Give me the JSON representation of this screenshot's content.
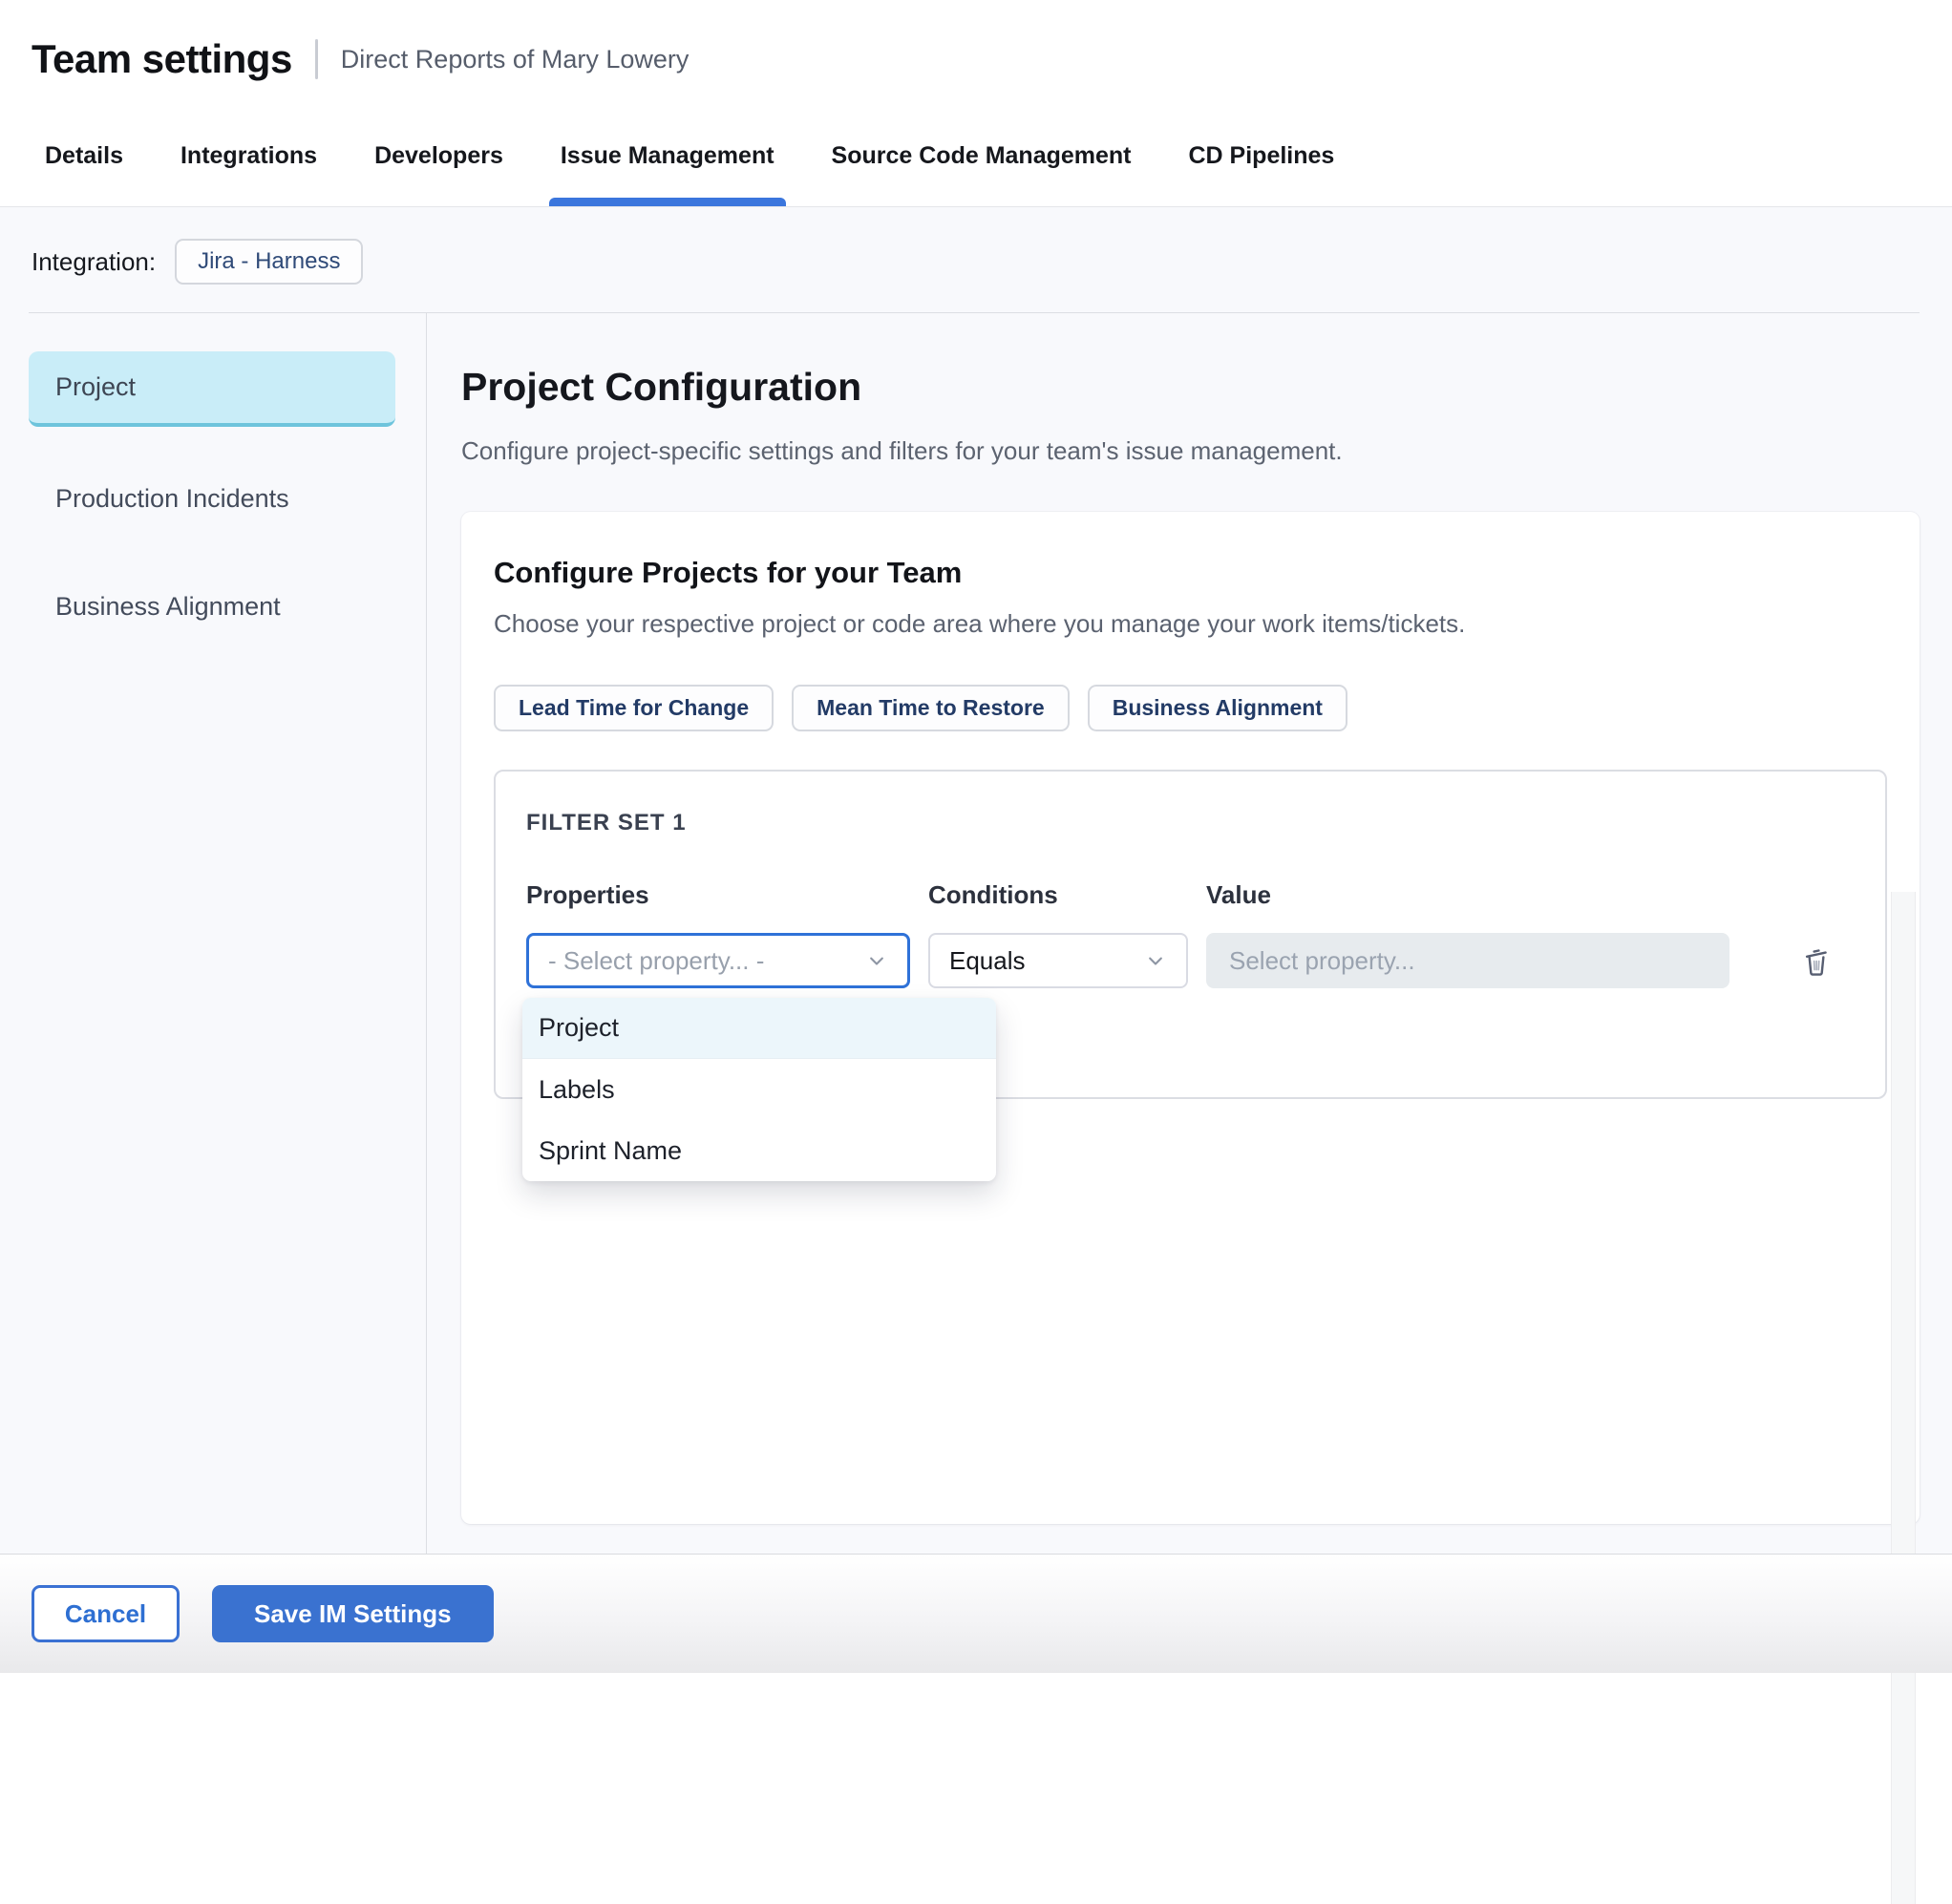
{
  "header": {
    "title": "Team settings",
    "subtitle": "Direct Reports of Mary Lowery"
  },
  "tabs": {
    "items": [
      {
        "label": "Details",
        "active": false
      },
      {
        "label": "Integrations",
        "active": false
      },
      {
        "label": "Developers",
        "active": false
      },
      {
        "label": "Issue Management",
        "active": true
      },
      {
        "label": "Source Code Management",
        "active": false
      },
      {
        "label": "CD Pipelines",
        "active": false
      }
    ]
  },
  "integration": {
    "label": "Integration:",
    "chip": "Jira - Harness"
  },
  "sidebar": {
    "items": [
      {
        "label": "Project",
        "active": true
      },
      {
        "label": "Production Incidents",
        "active": false
      },
      {
        "label": "Business Alignment",
        "active": false
      }
    ]
  },
  "main": {
    "title": "Project Configuration",
    "subtitle": "Configure project-specific settings and filters for your team's issue management.",
    "card": {
      "title": "Configure Projects for your Team",
      "subtitle": "Choose your respective project or code area where you manage your work items/tickets.",
      "chips": [
        "Lead Time for Change",
        "Mean Time to Restore",
        "Business Alignment"
      ],
      "filter_set": {
        "title": "FILTER SET 1",
        "columns": {
          "properties": "Properties",
          "conditions": "Conditions",
          "value": "Value"
        },
        "properties_placeholder": "- Select property... -",
        "conditions_value": "Equals",
        "value_placeholder": "Select property..."
      },
      "dropdown": {
        "options": [
          {
            "label": "Project",
            "highlighted": true
          },
          {
            "label": "Labels",
            "highlighted": false
          },
          {
            "label": "Sprint Name",
            "highlighted": false
          }
        ]
      }
    }
  },
  "footer": {
    "cancel_label": "Cancel",
    "save_label": "Save IM Settings"
  },
  "icons": {
    "properties_select": "chevron-down",
    "conditions_select": "chevron-down",
    "delete_filter": "trash"
  },
  "colors": {
    "accent_blue": "#3b76dd",
    "save_button": "#3a72d0",
    "cancel_border": "#3a71d3",
    "sidebar_active_bg": "#c9edf8",
    "sidebar_active_border": "#6ec4dc",
    "dropdown_highlight": "#ecf6fb",
    "value_input_bg": "#e7ebee",
    "chip_text": "#233b66",
    "content_bg": "#f8f9fc",
    "focused_select_border": "#2f72d8"
  }
}
